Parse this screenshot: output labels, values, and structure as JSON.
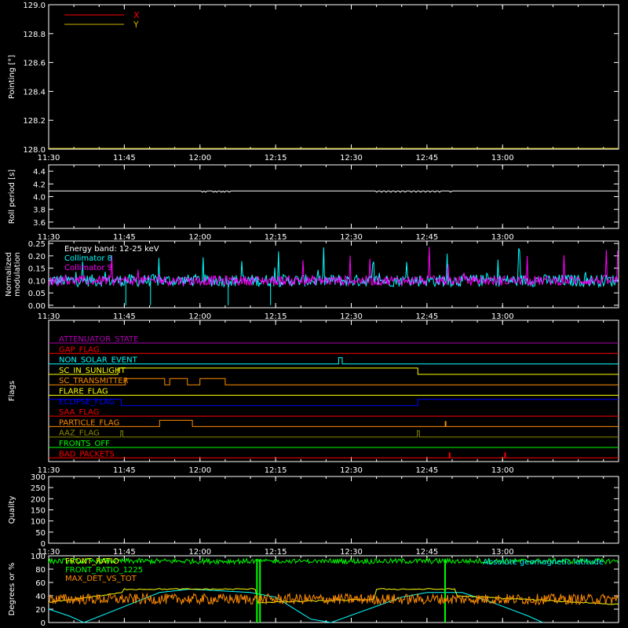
{
  "colors": {
    "background": "#000000",
    "axis": "#ffffff",
    "red": "#ff0000",
    "yellow_x": "#c8b400",
    "cyan": "#00ffff",
    "magenta": "#ff00ff",
    "yellow": "#ffff00",
    "orange": "#ff8c00",
    "blue": "#0000ff",
    "olive": "#8b8b00",
    "green": "#00ff00",
    "purple": "#b000b0"
  },
  "time_ticks": [
    "11:30",
    "11:45",
    "12:00",
    "12:15",
    "12:30",
    "12:45",
    "13:00"
  ],
  "chart_data": [
    {
      "id": "pointing",
      "type": "line",
      "ylabel": "Pointing [°]",
      "ylim": [
        128.0,
        129.0
      ],
      "yticks": [
        "128.0",
        "128.2",
        "128.4",
        "128.6",
        "128.8",
        "129.0"
      ],
      "legend": [
        {
          "name": "X",
          "color": "#ff0000"
        },
        {
          "name": "Y",
          "color": "#c8b400"
        }
      ],
      "series": [
        {
          "name": "X",
          "values": []
        },
        {
          "name": "Y",
          "values": []
        }
      ]
    },
    {
      "id": "roll",
      "type": "line",
      "ylabel": "Roll period [s]",
      "ylim": [
        3.5,
        4.5
      ],
      "yticks": [
        "3.6",
        "3.8",
        "4.0",
        "4.2",
        "4.4"
      ],
      "series": [
        {
          "name": "Roll period",
          "constant": 4.09
        }
      ]
    },
    {
      "id": "modulation",
      "type": "line",
      "ylabel": "Normalized modulation",
      "ylim": [
        -0.01,
        0.26
      ],
      "yticks": [
        "0.00",
        "0.05",
        "0.10",
        "0.15",
        "0.20",
        "0.25"
      ],
      "annotation": "Energy band: 12-25 keV",
      "series": [
        {
          "name": "Collimator 8",
          "color": "#00ffff",
          "baseline": 0.1
        },
        {
          "name": "Collimator 9",
          "color": "#ff00ff",
          "baseline": 0.1
        }
      ]
    },
    {
      "id": "flags",
      "type": "line",
      "ylabel": "Flags",
      "flags": [
        {
          "name": "ATTENUATOR_STATE",
          "color": "#b000b0"
        },
        {
          "name": "GAP_FLAG",
          "color": "#ff0000"
        },
        {
          "name": "NON_SOLAR_EVENT",
          "color": "#00ffff"
        },
        {
          "name": "SC_IN_SUNLIGHT",
          "color": "#ffff00"
        },
        {
          "name": "SC_TRANSMITTER",
          "color": "#ff8c00"
        },
        {
          "name": "FLARE_FLAG",
          "color": "#ffff00"
        },
        {
          "name": "ECLIPSE_FLAG",
          "color": "#0000ff"
        },
        {
          "name": "SAA_FLAG",
          "color": "#ff0000"
        },
        {
          "name": "PARTICLE_FLAG",
          "color": "#ff8c00"
        },
        {
          "name": "AAZ_FLAG",
          "color": "#8b8b00"
        },
        {
          "name": "FRONTS_OFF",
          "color": "#00ff00"
        },
        {
          "name": "BAD_PACKETS",
          "color": "#ff0000"
        }
      ]
    },
    {
      "id": "quality",
      "type": "line",
      "ylabel": "Quality",
      "ylim": [
        0,
        300
      ],
      "yticks": [
        "0",
        "50",
        "100",
        "150",
        "200",
        "250",
        "300"
      ],
      "series": []
    },
    {
      "id": "degrees",
      "type": "line",
      "ylabel": "Degrees or %",
      "ylim": [
        0,
        100
      ],
      "yticks": [
        "0",
        "20",
        "40",
        "60",
        "80",
        "100"
      ],
      "legend": [
        {
          "name": "FRONT_RATIO",
          "color": "#ffff00"
        },
        {
          "name": "FRONT_RATIO_1225",
          "color": "#00ff00"
        },
        {
          "name": "MAX_DET_VS_TOT",
          "color": "#ff8c00"
        }
      ],
      "annotation": "Absolute geomagnetic latitude",
      "annotation_color": "#00ffff"
    }
  ]
}
